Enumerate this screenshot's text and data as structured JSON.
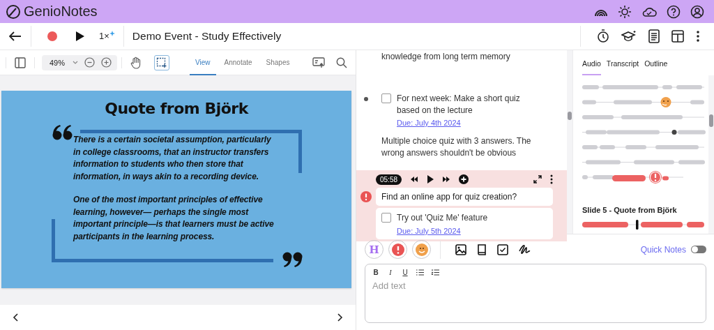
{
  "app": {
    "logo": "**Genio**Notes"
  },
  "header": {
    "speed": "1×",
    "title": "Demo Event - Study Effectively"
  },
  "toolbar": {
    "zoom": "49%",
    "tabs": [
      {
        "label": "View",
        "selected": true
      },
      {
        "label": "Annotate",
        "selected": false
      },
      {
        "label": "Shapes",
        "selected": false
      }
    ]
  },
  "slide": {
    "title": "Quote from Björk",
    "paragraphs": [
      "There is a certain societal assumption, particularly in college classrooms, that an instructor transfers information to students who then store that information, in ways akin to a recording device.",
      "One of the most important principles of effective learning, however— perhaps the single most important principle—is that learners must be active participants in the learning process."
    ]
  },
  "notes": [
    {
      "kind": "text",
      "text": "knowledge from long term memory"
    },
    {
      "kind": "task",
      "text": "For next week: Make a short quiz based on the lecture",
      "checked": false,
      "due": "Due: July 4th 2024"
    },
    {
      "kind": "text",
      "text": "Multiple choice quiz with 3 answers. The wrong answers shouldn't be obvious"
    }
  ],
  "flagged": {
    "time": "05:58",
    "question": "Find an online app for quiz creation?",
    "task": {
      "text": "Try out 'Quiz Me' feature",
      "checked": false,
      "due": "Due: July 5th 2024"
    }
  },
  "side": {
    "tabs": [
      {
        "label": "Audio",
        "selected": true
      },
      {
        "label": "Transcript",
        "selected": false
      },
      {
        "label": "Outline",
        "selected": false
      }
    ],
    "section_title": "Slide 5 - Quote from Björk"
  },
  "composer": {
    "heading_button": "H",
    "quick_notes": {
      "label": "Quick Notes",
      "on": false
    },
    "format_buttons": [
      "B",
      "I",
      "U"
    ],
    "placeholder": "Add text"
  }
}
